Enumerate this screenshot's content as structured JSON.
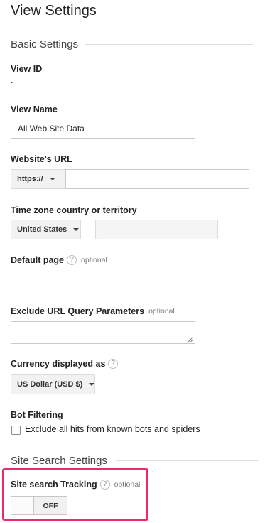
{
  "page_title": "View Settings",
  "basic_settings": {
    "header": "Basic Settings",
    "view_id": {
      "label": "View ID",
      "value": "."
    },
    "view_name": {
      "label": "View Name",
      "value": "All Web Site Data"
    },
    "website_url": {
      "label": "Website's URL",
      "protocol": "https://",
      "value": ""
    },
    "timezone": {
      "label": "Time zone country or territory",
      "country": "United States",
      "timezone_value": ""
    },
    "default_page": {
      "label": "Default page",
      "optional": "optional",
      "value": ""
    },
    "exclude_params": {
      "label": "Exclude URL Query Parameters",
      "optional": "optional",
      "value": ""
    },
    "currency": {
      "label": "Currency displayed as",
      "value": "US Dollar (USD $)"
    },
    "bot_filtering": {
      "label": "Bot Filtering",
      "checkbox_label": "Exclude all hits from known bots and spiders",
      "checked": false
    }
  },
  "site_search": {
    "header": "Site Search Settings",
    "tracking": {
      "label": "Site search Tracking",
      "optional": "optional",
      "toggle_state": "OFF"
    }
  },
  "colors": {
    "highlight": "#ee2a6b",
    "rule": "#dddddd",
    "button_bg": "#f2f2f2"
  },
  "icons": {
    "help": "help-icon",
    "dropdown": "chevron-down-icon"
  },
  "help_glyph": "?"
}
